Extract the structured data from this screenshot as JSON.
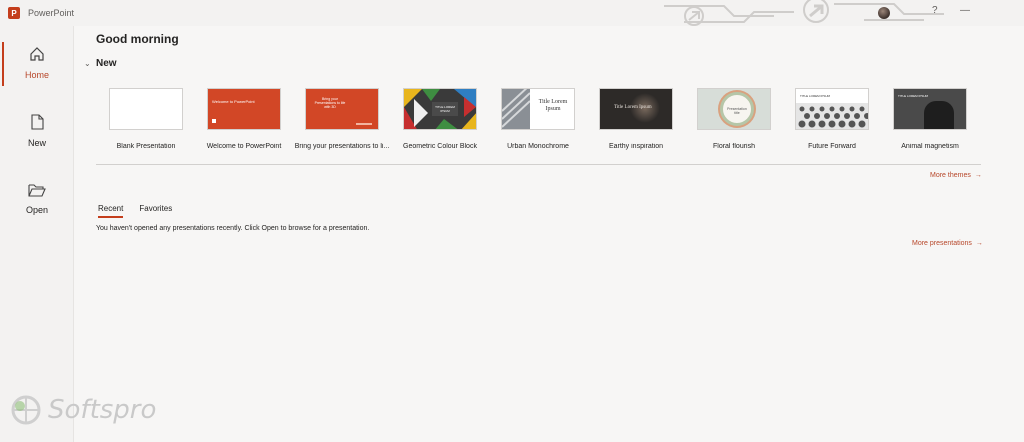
{
  "app": {
    "name": "PowerPoint",
    "logo_letter": "P",
    "accent_color": "#c43e1c"
  },
  "titlebar": {
    "avatar_icon": "user-avatar",
    "help_icon": "help-icon",
    "help_label": "?",
    "minimize_label": "—"
  },
  "nav": {
    "items": [
      {
        "label": "Home",
        "icon": "home-icon",
        "active": true
      },
      {
        "label": "New",
        "icon": "new-file-icon",
        "active": false
      },
      {
        "label": "Open",
        "icon": "folder-open-icon",
        "active": false
      }
    ]
  },
  "main": {
    "greeting": "Good morning",
    "new_section_title": "New",
    "templates": [
      {
        "label": "Blank Presentation",
        "thumb_title": ""
      },
      {
        "label": "Welcome to PowerPoint",
        "thumb_title": "Welcome to PowerPoint"
      },
      {
        "label": "Bring your presentations to li...",
        "thumb_title": "Bring your Presentations to life with 3D"
      },
      {
        "label": "Geometric Colour Block",
        "thumb_title": "TITLE LOREM IPSUM"
      },
      {
        "label": "Urban Monochrome",
        "thumb_title": "Title Lorem Ipsum"
      },
      {
        "label": "Earthy inspiration",
        "thumb_title": "Title Lorem Ipsum"
      },
      {
        "label": "Floral flourish",
        "thumb_title": "Presentation title"
      },
      {
        "label": "Future Forward",
        "thumb_title": "TITLE LOREM IPSUM"
      },
      {
        "label": "Animal magnetism",
        "thumb_title": "TITLE LOREM IPSUM"
      }
    ],
    "more_themes": "More themes",
    "tabs": [
      {
        "label": "Recent",
        "selected": true
      },
      {
        "label": "Favorites",
        "selected": false
      }
    ],
    "empty_message": "You haven't opened any presentations recently. Click Open to browse for a presentation.",
    "more_presentations": "More presentations"
  },
  "watermark": {
    "text": "Softspro"
  }
}
